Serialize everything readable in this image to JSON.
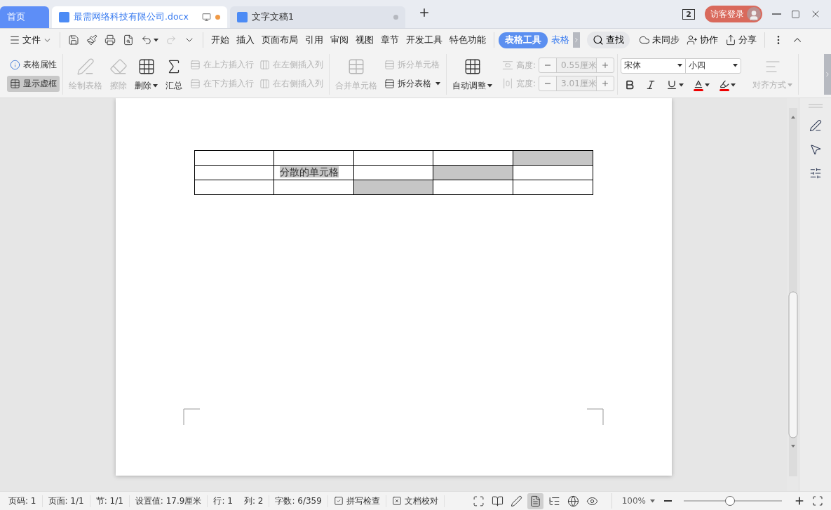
{
  "tabs": [
    {
      "label": "首页",
      "kind": "home",
      "selected": false
    },
    {
      "label": "最需网络科技有限公司.docx",
      "kind": "doc",
      "selected": true,
      "modified": true
    },
    {
      "label": "文字文稿1",
      "kind": "doc",
      "selected": false,
      "modified": false
    }
  ],
  "titlebar": {
    "window_count": "2",
    "login": "访客登录"
  },
  "menu": {
    "file": "文件",
    "ribbon_tabs": [
      {
        "label": "开始",
        "selected": false
      },
      {
        "label": "插入",
        "selected": false
      },
      {
        "label": "页面布局",
        "selected": false
      },
      {
        "label": "引用",
        "selected": false
      },
      {
        "label": "审阅",
        "selected": false
      },
      {
        "label": "视图",
        "selected": false
      },
      {
        "label": "章节",
        "selected": false
      },
      {
        "label": "开发工具",
        "selected": false
      },
      {
        "label": "特色功能",
        "selected": false
      },
      {
        "label": "表格工具",
        "selected": true
      },
      {
        "label": "表格",
        "selected": false
      }
    ],
    "search": "查找",
    "actions": [
      {
        "label": "未同步",
        "kind": "cloud"
      },
      {
        "label": "协作",
        "kind": "people"
      },
      {
        "label": "分享",
        "kind": "share"
      }
    ]
  },
  "ribbon": {
    "toggles": [
      {
        "label": "表格属性",
        "selected": false
      },
      {
        "label": "显示虚框",
        "selected": true
      }
    ],
    "large_buttons": [
      {
        "label": "绘制表格",
        "kind": "draw",
        "disabled": true,
        "dropdown": false
      },
      {
        "label": "擦除",
        "kind": "erase",
        "disabled": true,
        "dropdown": false
      },
      {
        "label": "删除",
        "kind": "delete",
        "disabled": false,
        "dropdown": true
      },
      {
        "label": "汇总",
        "kind": "sum",
        "disabled": false,
        "dropdown": false
      }
    ],
    "insert_buttons": [
      {
        "label": "在上方插入行",
        "kind": "row",
        "disabled": true
      },
      {
        "label": "在下方插入行",
        "kind": "row",
        "disabled": true
      },
      {
        "label": "在左侧插入列",
        "kind": "column",
        "disabled": true
      },
      {
        "label": "在右侧插入列",
        "kind": "column",
        "disabled": true
      }
    ],
    "merge": {
      "label": "合并单元格",
      "disabled": true
    },
    "split_buttons": [
      {
        "label": "拆分单元格",
        "disabled": true,
        "dropdown": false
      },
      {
        "label": "拆分表格",
        "disabled": false,
        "dropdown": true
      }
    ],
    "autofit": {
      "label": "自动调整",
      "disabled": false
    },
    "size_fields": [
      {
        "label": "高度:",
        "value": "0.55厘米",
        "kind": "height",
        "disabled": true
      },
      {
        "label": "宽度:",
        "value": "3.01厘米",
        "kind": "width",
        "disabled": true
      }
    ],
    "font": {
      "family": "宋体",
      "size": "小四"
    },
    "align": {
      "label": "对齐方式",
      "disabled": true
    }
  },
  "document": {
    "table": [
      [
        {
          "shaded": false
        },
        {
          "shaded": false
        },
        {
          "shaded": false
        },
        {
          "shaded": false
        },
        {
          "shaded": true
        }
      ],
      [
        {
          "shaded": false
        },
        {
          "text": "分散的单元格",
          "shaded": false,
          "text_highlight": true
        },
        {
          "shaded": false
        },
        {
          "shaded": true
        },
        {
          "shaded": false
        }
      ],
      [
        {
          "shaded": false
        },
        {
          "shaded": false
        },
        {
          "shaded": true
        },
        {
          "shaded": false
        },
        {
          "shaded": false
        }
      ]
    ]
  },
  "status_bar": {
    "items": [
      {
        "label": "页码: 1",
        "kind": "text"
      },
      {
        "label": "页面: 1/1",
        "kind": "text"
      },
      {
        "label": "节: 1/1",
        "kind": "text"
      },
      {
        "label": "设置值: 17.9厘米",
        "kind": "text"
      },
      {
        "label": "行: 1",
        "kind": "text"
      },
      {
        "label": "列: 2",
        "kind": "text"
      },
      {
        "label": "字数: 6/359",
        "kind": "text"
      },
      {
        "label": "拼写检查",
        "kind": "spell"
      },
      {
        "label": "文档校对",
        "kind": "proof"
      }
    ],
    "views": [
      {
        "kind": "fullscreen",
        "selected": false
      },
      {
        "kind": "read",
        "selected": false
      },
      {
        "kind": "write",
        "selected": false
      },
      {
        "kind": "page",
        "selected": true
      },
      {
        "kind": "outline",
        "selected": false
      },
      {
        "kind": "web",
        "selected": false
      },
      {
        "kind": "eye",
        "selected": false
      }
    ],
    "zoom": {
      "value": "100%",
      "level": 0.47
    }
  }
}
